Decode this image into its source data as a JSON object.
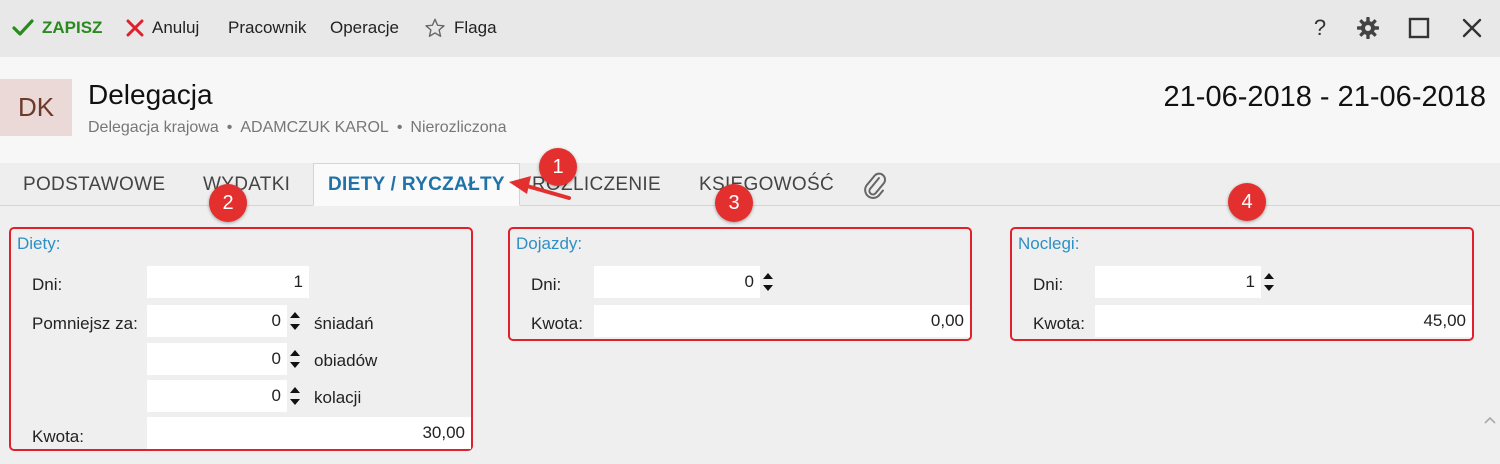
{
  "toolbar": {
    "save_label": "ZAPISZ",
    "cancel_label": "Anuluj",
    "worker_label": "Pracownik",
    "operations_label": "Operacje",
    "flag_label": "Flaga",
    "help_label": "?"
  },
  "header": {
    "avatar_text": "DK",
    "title": "Delegacja",
    "subtitle_parts": [
      "Delegacja krajowa",
      "ADAMCZUK KAROL",
      "Nierozliczona"
    ],
    "separator": "•",
    "date_range": "21-06-2018 - 21-06-2018"
  },
  "tabs": [
    {
      "label": "PODSTAWOWE",
      "active": false
    },
    {
      "label": "WYDATKI",
      "active": false
    },
    {
      "label": "DIETY / RYCZAŁTY",
      "active": true
    },
    {
      "label": "ROZLICZENIE",
      "active": false
    },
    {
      "label": "KSIĘGOWOŚĆ",
      "active": false
    }
  ],
  "diety": {
    "title": "Diety:",
    "days_label": "Dni:",
    "days_value": "1",
    "reduce_label": "Pomniejsz za:",
    "breakfast_value": "0",
    "breakfast_suffix": "śniadań",
    "lunch_value": "0",
    "lunch_suffix": "obiadów",
    "dinner_value": "0",
    "dinner_suffix": "kolacji",
    "amount_label": "Kwota:",
    "amount_value": "30,00"
  },
  "dojazdy": {
    "title": "Dojazdy:",
    "days_label": "Dni:",
    "days_value": "0",
    "amount_label": "Kwota:",
    "amount_value": "0,00"
  },
  "noclegi": {
    "title": "Noclegi:",
    "days_label": "Dni:",
    "days_value": "1",
    "amount_label": "Kwota:",
    "amount_value": "45,00"
  },
  "callouts": [
    "1",
    "2",
    "3",
    "4"
  ],
  "colors": {
    "accent": "#1f73a8",
    "section_title": "#2f8fc4",
    "save_green": "#2a8a1f",
    "callout_red": "#e3302f",
    "avatar_bg": "#ead9d6"
  },
  "icons": {
    "save": "checkmark-icon",
    "cancel": "x-icon",
    "flag": "star-icon",
    "help": "question-icon",
    "settings": "gear-icon",
    "maximize": "square-icon",
    "close": "close-icon",
    "attachment": "paperclip-icon"
  }
}
